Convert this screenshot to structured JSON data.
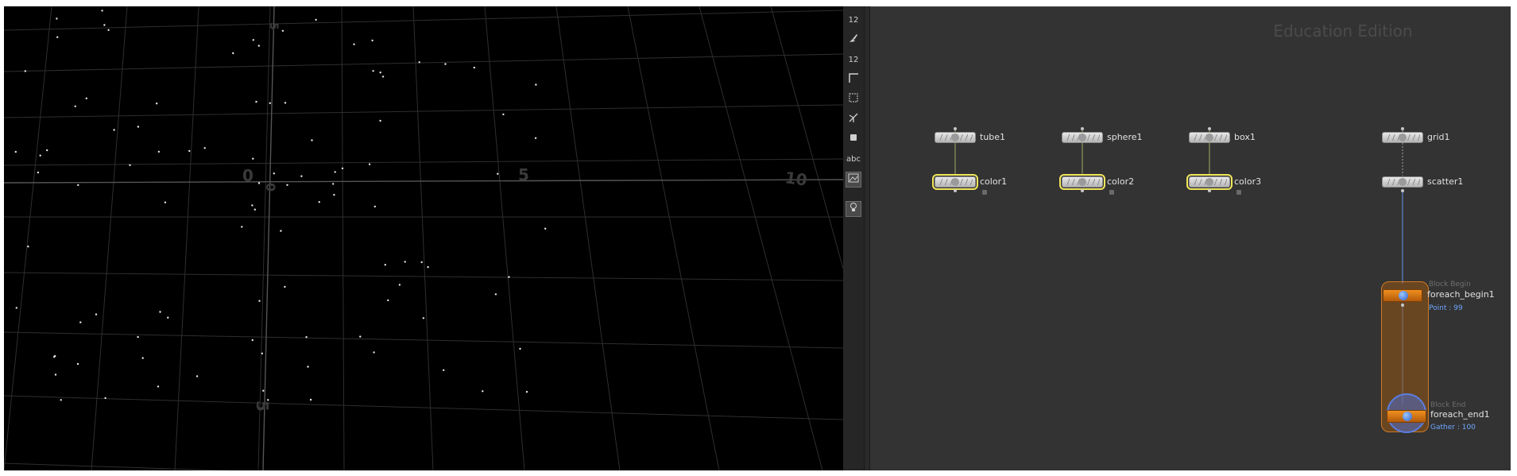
{
  "viewport": {
    "axis_labels": [
      {
        "text": "5"
      },
      {
        "text": "0"
      },
      {
        "text": "0"
      },
      {
        "text": "5"
      },
      {
        "text": "10"
      },
      {
        "text": "5"
      }
    ]
  },
  "toolbar": {
    "buttons": [
      {
        "name": "point-numbers-icon",
        "label": "12"
      },
      {
        "name": "brush-icon",
        "label": ""
      },
      {
        "name": "prim-numbers-icon",
        "label": "12"
      },
      {
        "name": "corner-icon",
        "label": ""
      },
      {
        "name": "bounding-box-icon",
        "label": ""
      },
      {
        "name": "normals-icon",
        "label": ""
      },
      {
        "name": "stop-icon",
        "label": ""
      },
      {
        "name": "text-abc-icon",
        "label": "abc"
      },
      {
        "name": "image-overlay-icon",
        "label": ""
      },
      {
        "name": "lightbulb-icon",
        "label": ""
      }
    ]
  },
  "network": {
    "watermark": "Education Edition",
    "nodes": {
      "tube1": "tube1",
      "sphere1": "sphere1",
      "box1": "box1",
      "grid1": "grid1",
      "color1": "color1",
      "color2": "color2",
      "color3": "color3",
      "scatter1": "scatter1",
      "foreach_begin1": "foreach_begin1",
      "foreach_end1": "foreach_end1"
    },
    "block_begin": {
      "type_label": "Block Begin",
      "info": "Point : 99"
    },
    "block_end": {
      "type_label": "Block End",
      "info": "Gather : 100"
    }
  },
  "colors": {
    "selected_outline": "#f2e65b",
    "block_orange": "#e0801a",
    "info_blue": "#6fa6ff",
    "end_ring": "#5a7ee0"
  }
}
